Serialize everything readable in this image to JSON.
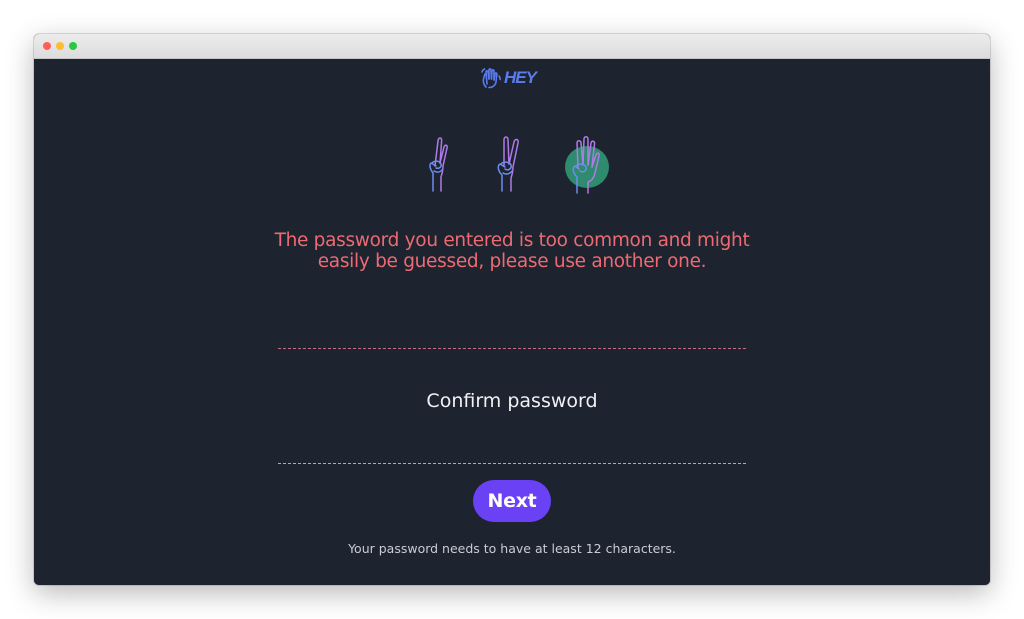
{
  "window": {
    "controls": [
      "close",
      "minimize",
      "zoom"
    ]
  },
  "logo": {
    "text": "HEY",
    "icon": "waving-hand-icon"
  },
  "illustration": {
    "icons": [
      "peace-hand-icon",
      "peace-hand-icon",
      "waving-hand-icon"
    ]
  },
  "error": {
    "message": "The password you entered is too common and might easily be guessed, please use another one."
  },
  "form": {
    "confirm_password_placeholder": "Confirm password",
    "confirm_password_value": "",
    "next_label": "Next",
    "hint": "Your password needs to have at least 12 characters."
  },
  "colors": {
    "background": "#1d2430",
    "error": "#ee6a72",
    "button": "#6a41f5",
    "logo": "#5b7cf0",
    "hand_accent": "#2e8b6e"
  }
}
